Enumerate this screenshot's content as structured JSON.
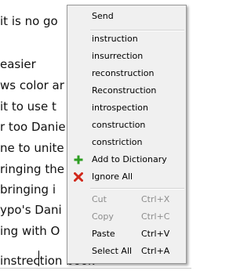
{
  "document": {
    "lines": [
      "  it is no go",
      "easier",
      "ws color ar",
      "  it to use t",
      "r too Danie",
      "ne to unite",
      "ringing the",
      " bringing i",
      "ypo's Dani",
      "ing with  O"
    ],
    "edit_line": "  instrection book"
  },
  "context_menu": {
    "send": "Send",
    "suggestions": [
      "instruction",
      "insurrection",
      "reconstruction",
      "Reconstruction",
      "introspection",
      "construction",
      "constriction"
    ],
    "add_to_dictionary": "Add to Dictionary",
    "ignore_all": "Ignore All",
    "cut": {
      "label": "Cut",
      "shortcut": "Ctrl+X"
    },
    "copy": {
      "label": "Copy",
      "shortcut": "Ctrl+C"
    },
    "paste": {
      "label": "Paste",
      "shortcut": "Ctrl+V"
    },
    "select_all": {
      "label": "Select All",
      "shortcut": "Ctrl+A"
    }
  },
  "icons": {
    "add_to_dictionary": "plus-icon",
    "ignore_all": "x-icon"
  },
  "colors": {
    "add_icon": "#2e9e22",
    "ignore_icon": "#d1281b",
    "disabled_text": "#8d8d8d",
    "menu_background": "#f0f0f0"
  }
}
